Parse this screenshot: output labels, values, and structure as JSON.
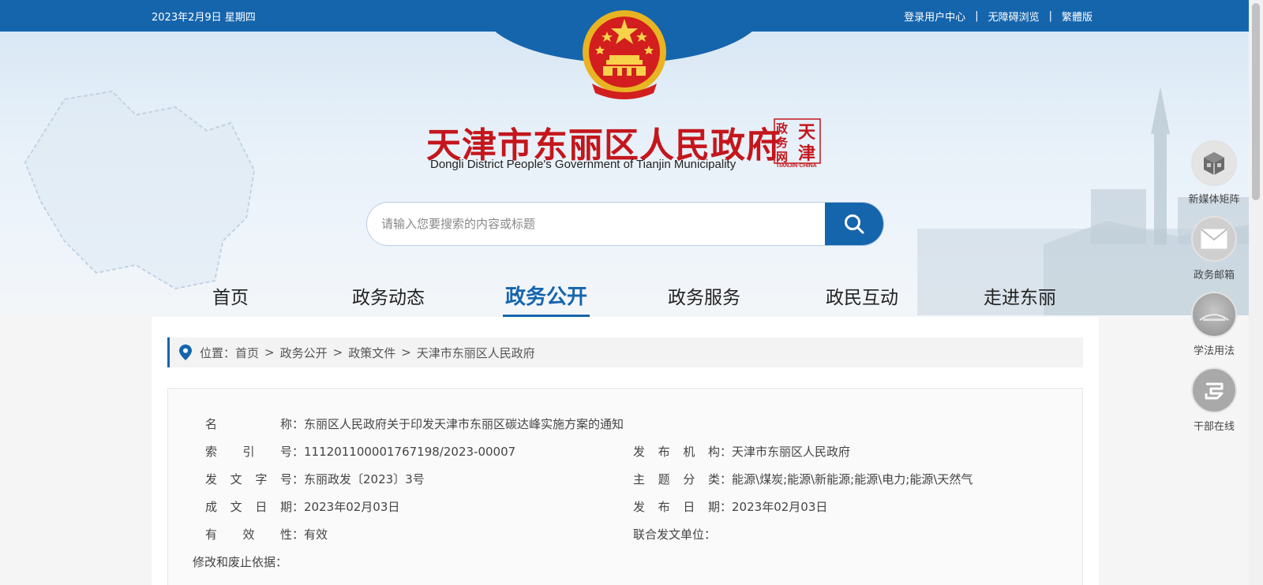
{
  "topbar": {
    "date": "2023年2月9日 星期四",
    "links": [
      "登录用户中心",
      "无障碍浏览",
      "繁體版"
    ],
    "separator": "|"
  },
  "header": {
    "title": "天津市东丽区人民政府",
    "subtitle": "Dongli District People's Government of Tianjin Municipality",
    "seal_text": "TIANJIN·CHINA",
    "seal_chars": [
      "天",
      "津",
      "政",
      "务",
      "网"
    ]
  },
  "search": {
    "placeholder": "请输入您要搜索的内容或标题"
  },
  "nav": {
    "items": [
      "首页",
      "政务动态",
      "政务公开",
      "政务服务",
      "政民互动",
      "走进东丽"
    ],
    "active": "政务公开"
  },
  "breadcrumb": {
    "prefix": "位置：",
    "items": [
      "首页",
      "政务公开",
      "政策文件",
      "天津市东丽区人民政府"
    ],
    "separator": ">"
  },
  "info": {
    "name_label": "名称",
    "name_value": "东丽区人民政府关于印发天津市东丽区碳达峰实施方案的通知",
    "index_label": "索引号",
    "index_value": "111201100001767198/2023-00007",
    "issuer_label": "发布机构",
    "issuer_value": "天津市东丽区人民政府",
    "docno_label": "发文字号",
    "docno_value": "东丽政发〔2023〕3号",
    "topic_label": "主题分类",
    "topic_value": "能源\\煤炭;能源\\新能源;能源\\电力;能源\\天然气",
    "made_label": "成文日期",
    "made_value": "2023年02月03日",
    "pub_label": "发布日期",
    "pub_value": "2023年02月03日",
    "valid_label": "有效性",
    "valid_value": "有效",
    "joint_label": "联合发文单位",
    "amend_label": "修改和废止依据",
    "colon": "："
  },
  "side_tools": [
    {
      "label": "新媒体矩阵",
      "icon": "cube-icon"
    },
    {
      "label": "政务邮箱",
      "icon": "mail-icon"
    },
    {
      "label": "学法用法",
      "icon": "law-icon"
    },
    {
      "label": "干部在线",
      "icon": "cadre-icon"
    }
  ],
  "colors": {
    "primary": "#1565ad",
    "title_red": "#c4161c",
    "emblem_gold": "#e8b422"
  }
}
